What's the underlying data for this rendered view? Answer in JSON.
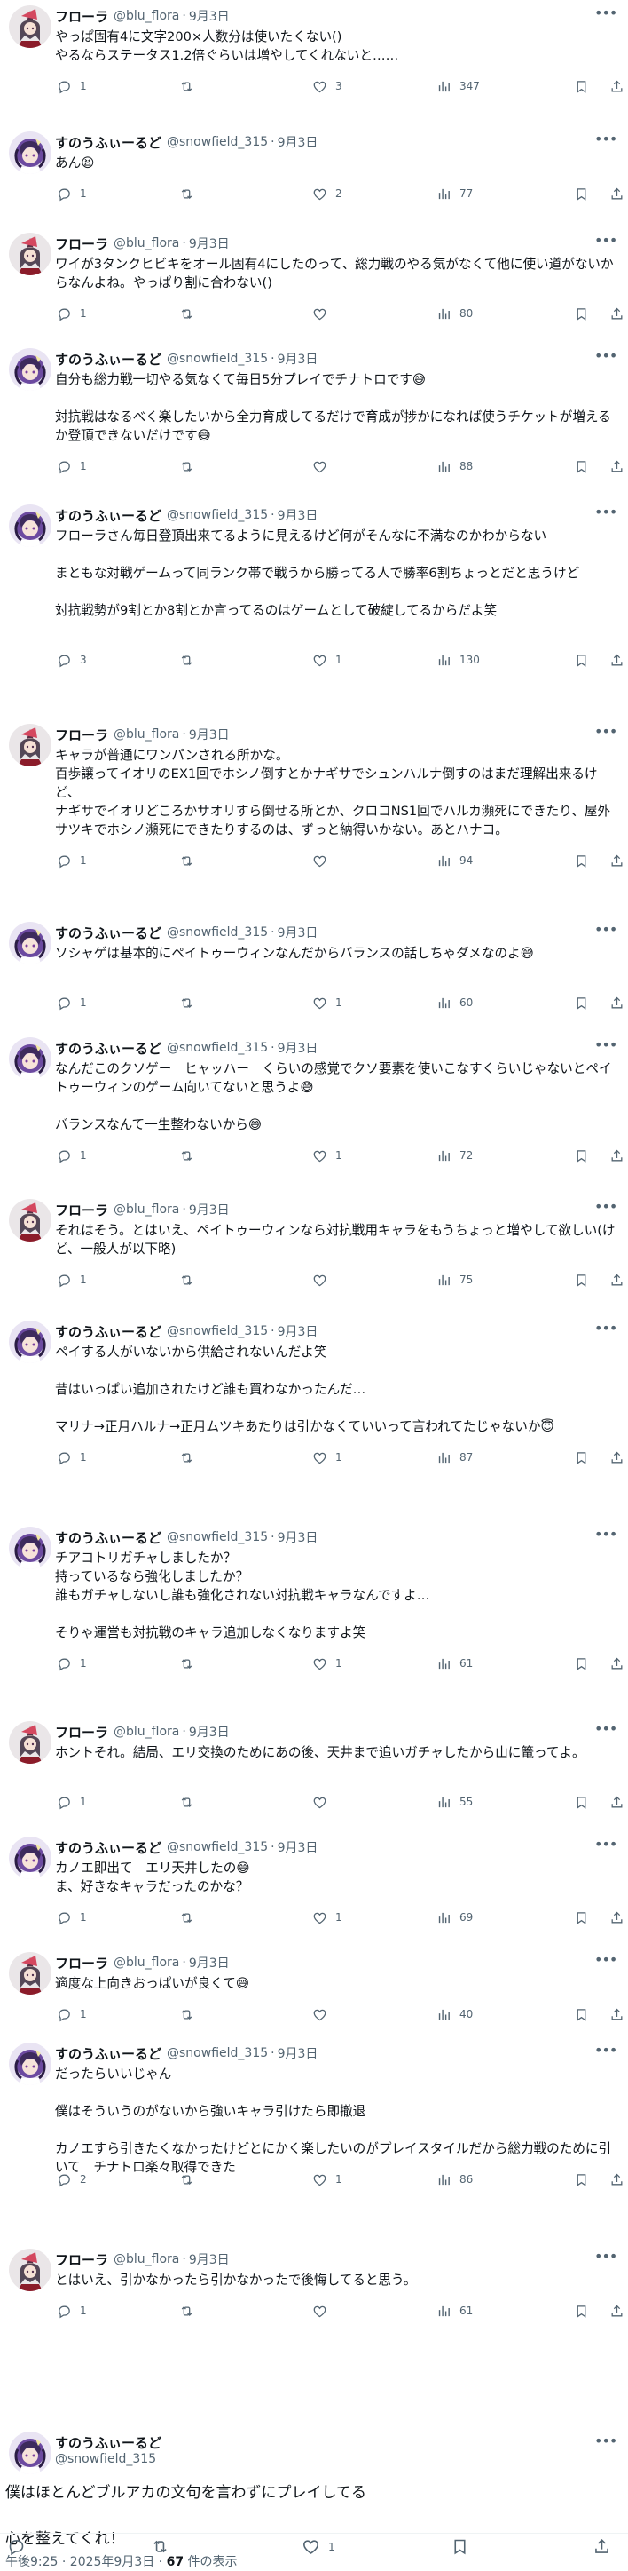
{
  "tweets": [
    {
      "name": "フローラ",
      "handle": "@blu_flora",
      "date": "9月3日",
      "avatar": "flora",
      "text": "やっぱ固有4に文字200×人数分は使いたくない()\nやるならステータス1.2倍ぐらいは増やしてくれないと……",
      "replies": "1",
      "retweets": "",
      "likes": "3",
      "views": "347"
    },
    {
      "name": "すのうふぃーるど",
      "handle": "@snowfield_315",
      "date": "9月3日",
      "avatar": "snow",
      "text": "あん😫",
      "replies": "1",
      "retweets": "",
      "likes": "2",
      "views": "77"
    },
    {
      "name": "フローラ",
      "handle": "@blu_flora",
      "date": "9月3日",
      "avatar": "flora",
      "text": "ワイが3タンクヒビキをオール固有4にしたのって、総力戦のやる気がなくて他に使い道がないからなんよね。やっぱり割に合わない()",
      "replies": "1",
      "retweets": "",
      "likes": "",
      "views": "80"
    },
    {
      "name": "すのうふぃーるど",
      "handle": "@snowfield_315",
      "date": "9月3日",
      "avatar": "snow",
      "text": "自分も総力戦一切やる気なくて毎日5分プレイでチナトロです😅\n\n対抗戦はなるべく楽したいから全力育成してるだけで育成が捗かになれば使うチケットが増えるか登頂できないだけです😅",
      "replies": "1",
      "retweets": "",
      "likes": "",
      "views": "88"
    },
    {
      "name": "すのうふぃーるど",
      "handle": "@snowfield_315",
      "date": "9月3日",
      "avatar": "snow",
      "text": "フローラさん毎日登頂出来てるように見えるけど何がそんなに不満なのかわからない\n\nまともな対戦ゲームって同ランク帯で戦うから勝ってる人で勝率6割ちょっとだと思うけど\n\n対抗戦勢が9割とか8割とか言ってるのはゲームとして破綻してるからだよ笑",
      "replies": "3",
      "retweets": "",
      "likes": "1",
      "views": "130"
    },
    {
      "name": "フローラ",
      "handle": "@blu_flora",
      "date": "9月3日",
      "avatar": "flora",
      "text": "キャラが普通にワンパンされる所かな。\n百歩譲ってイオリのEX1回でホシノ倒すとかナギサでシュンハルナ倒すのはまだ理解出来るけど、\nナギサでイオリどころかサオリすら倒せる所とか、クロコNS1回でハルカ瀕死にできたり、屋外サツキでホシノ瀕死にできたりするのは、ずっと納得いかない。あとハナコ。",
      "replies": "1",
      "retweets": "",
      "likes": "",
      "views": "94"
    },
    {
      "name": "すのうふぃーるど",
      "handle": "@snowfield_315",
      "date": "9月3日",
      "avatar": "snow",
      "text": "ソシャゲは基本的にペイトゥーウィンなんだからバランスの話しちゃダメなのよ😅",
      "replies": "1",
      "retweets": "",
      "likes": "1",
      "views": "60"
    },
    {
      "name": "すのうふぃーるど",
      "handle": "@snowfield_315",
      "date": "9月3日",
      "avatar": "snow",
      "text": "なんだこのクソゲー　ヒャッハー　くらいの感覚でクソ要素を使いこなすくらいじゃないとペイトゥーウィンのゲーム向いてないと思うよ😅\n\nバランスなんて一生整わないから😅",
      "replies": "1",
      "retweets": "",
      "likes": "1",
      "views": "72"
    },
    {
      "name": "フローラ",
      "handle": "@blu_flora",
      "date": "9月3日",
      "avatar": "flora",
      "text": "それはそう。とはいえ、ペイトゥーウィンなら対抗戦用キャラをもうちょっと増やして欲しい(けど、一般人が以下略)",
      "replies": "1",
      "retweets": "",
      "likes": "",
      "views": "75"
    },
    {
      "name": "すのうふぃーるど",
      "handle": "@snowfield_315",
      "date": "9月3日",
      "avatar": "snow",
      "text": "ペイする人がいないから供給されないんだよ笑\n\n昔はいっぱい追加されたけど誰も買わなかったんだ…\n\nマリナ→正月ハルナ→正月ムツキあたりは引かなくていいって言われてたじゃないか😇",
      "replies": "1",
      "retweets": "",
      "likes": "1",
      "views": "87"
    },
    {
      "name": "すのうふぃーるど",
      "handle": "@snowfield_315",
      "date": "9月3日",
      "avatar": "snow",
      "text": "チアコトリガチャしましたか？\n持っているなら強化しましたか？\n誰もガチャしないし誰も強化されない対抗戦キャラなんですよ…\n\nそりゃ運営も対抗戦のキャラ追加しなくなりますよ笑",
      "replies": "1",
      "retweets": "",
      "likes": "1",
      "views": "61"
    },
    {
      "name": "フローラ",
      "handle": "@blu_flora",
      "date": "9月3日",
      "avatar": "flora",
      "text": "ホントそれ。結局、エリ交換のためにあの後、天井まで追いガチャしたから山に篭ってよ。",
      "replies": "1",
      "retweets": "",
      "likes": "",
      "views": "55"
    },
    {
      "name": "すのうふぃーるど",
      "handle": "@snowfield_315",
      "date": "9月3日",
      "avatar": "snow",
      "text": "カノエ即出て　エリ天井したの😅\nま、好きなキャラだったのかな？",
      "replies": "1",
      "retweets": "",
      "likes": "1",
      "views": "69"
    },
    {
      "name": "フローラ",
      "handle": "@blu_flora",
      "date": "9月3日",
      "avatar": "flora",
      "text": "適度な上向きおっぱいが良くて😅",
      "replies": "1",
      "retweets": "",
      "likes": "",
      "views": "40"
    },
    {
      "name": "すのうふぃーるど",
      "handle": "@snowfield_315",
      "date": "9月3日",
      "avatar": "snow",
      "text": "だったらいいじゃん\n\n僕はそういうのがないから強いキャラ引けたら即撤退\n\nカノエすら引きたくなかったけどとにかく楽したいのがプレイスタイルだから総力戦のために引いて　チナトロ楽々取得できた",
      "replies": "2",
      "retweets": "",
      "likes": "1",
      "views": "86"
    },
    {
      "name": "フローラ",
      "handle": "@blu_flora",
      "date": "9月3日",
      "avatar": "flora",
      "text": "とはいえ、引かなかったら引かなかったで後悔してると思う。",
      "replies": "1",
      "retweets": "",
      "likes": "",
      "views": "61"
    }
  ],
  "main": {
    "name": "すのうふぃーるど",
    "handle": "@snowfield_315",
    "text": "僕はほとんどブルアカの文句を言わずにプレイしてる\n\n心を整えてくれ！",
    "time": "午後9:25 · 2025年9月3日 · ",
    "views": "67",
    "views_label": " 件の表示",
    "likes": "1"
  },
  "colors": {
    "text": "#0f1419",
    "muted": "#536471",
    "divider": "#eff3f4"
  }
}
